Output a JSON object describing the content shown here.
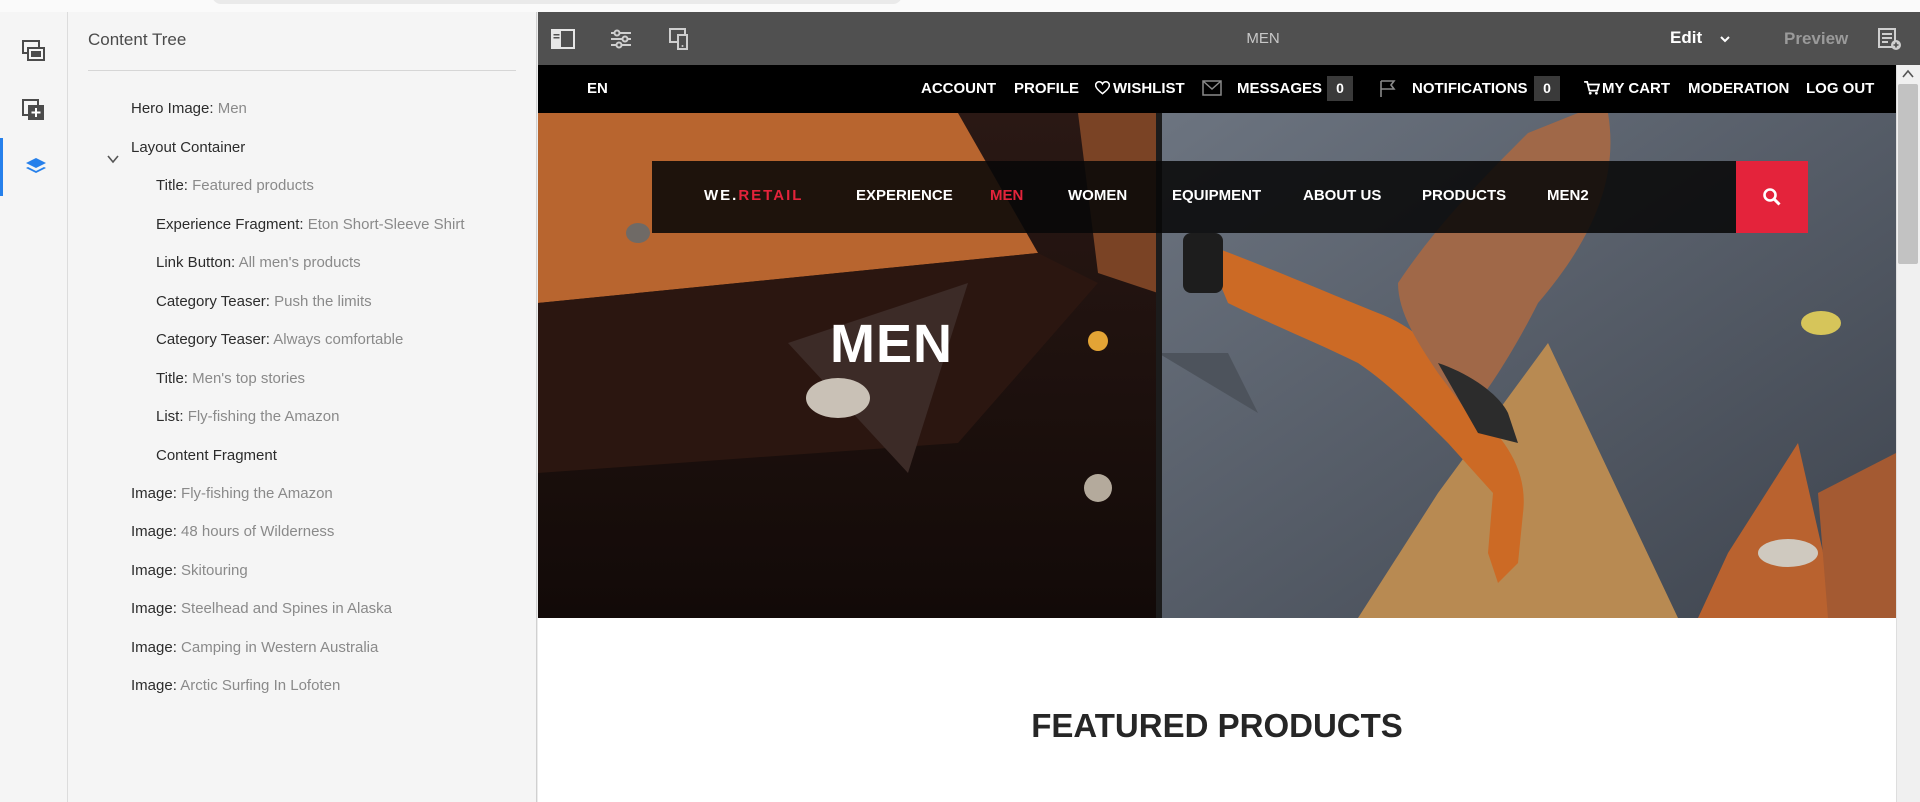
{
  "sidebar": {
    "title": "Content Tree",
    "icons": [
      "assets-icon",
      "components-icon",
      "content-tree-icon"
    ],
    "tree": [
      {
        "type": "Hero Image:",
        "value": "Men"
      },
      {
        "type": "Layout Container",
        "value": ""
      },
      {
        "type": "Title:",
        "value": "Featured products"
      },
      {
        "type": "Experience Fragment:",
        "value": "Eton Short-Sleeve Shirt"
      },
      {
        "type": "Link Button:",
        "value": "All men's products"
      },
      {
        "type": "Category Teaser:",
        "value": "Push the limits"
      },
      {
        "type": "Category Teaser:",
        "value": "Always comfortable"
      },
      {
        "type": "Title:",
        "value": "Men's top stories"
      },
      {
        "type": "List:",
        "value": "Fly-fishing the Amazon"
      },
      {
        "type": "Content Fragment",
        "value": ""
      },
      {
        "type": "Image:",
        "value": "Fly-fishing the Amazon"
      },
      {
        "type": "Image:",
        "value": "48 hours of Wilderness"
      },
      {
        "type": "Image:",
        "value": "Skitouring"
      },
      {
        "type": "Image:",
        "value": "Steelhead and Spines in Alaska"
      },
      {
        "type": "Image:",
        "value": "Camping in Western Australia"
      },
      {
        "type": "Image:",
        "value": "Arctic Surfing In Lofoten"
      }
    ]
  },
  "toolbar": {
    "page_title": "MEN",
    "mode": "Edit",
    "preview": "Preview",
    "icons": [
      "side-panel-icon",
      "page-properties-icon",
      "emulator-icon",
      "annotations-icon"
    ]
  },
  "site": {
    "language": "EN",
    "top_links": {
      "account": "ACCOUNT",
      "profile": "PROFILE",
      "wishlist": "WISHLIST",
      "messages": "MESSAGES",
      "messages_count": "0",
      "notifications": "NOTIFICATIONS",
      "notifications_count": "0",
      "cart": "MY CART",
      "moderation": "MODERATION",
      "logout": "LOG OUT"
    },
    "logo": {
      "we": "WE.",
      "retail": "RETAIL"
    },
    "nav": [
      "EXPERIENCE",
      "MEN",
      "WOMEN",
      "EQUIPMENT",
      "ABOUT US",
      "PRODUCTS",
      "MEN2"
    ],
    "nav_active": "MEN",
    "hero_title": "MEN",
    "featured_title": "FEATURED PRODUCTS"
  },
  "colors": {
    "accent": "#e4233b",
    "toolbar_bg": "#505050",
    "selection": "#2680eb"
  }
}
